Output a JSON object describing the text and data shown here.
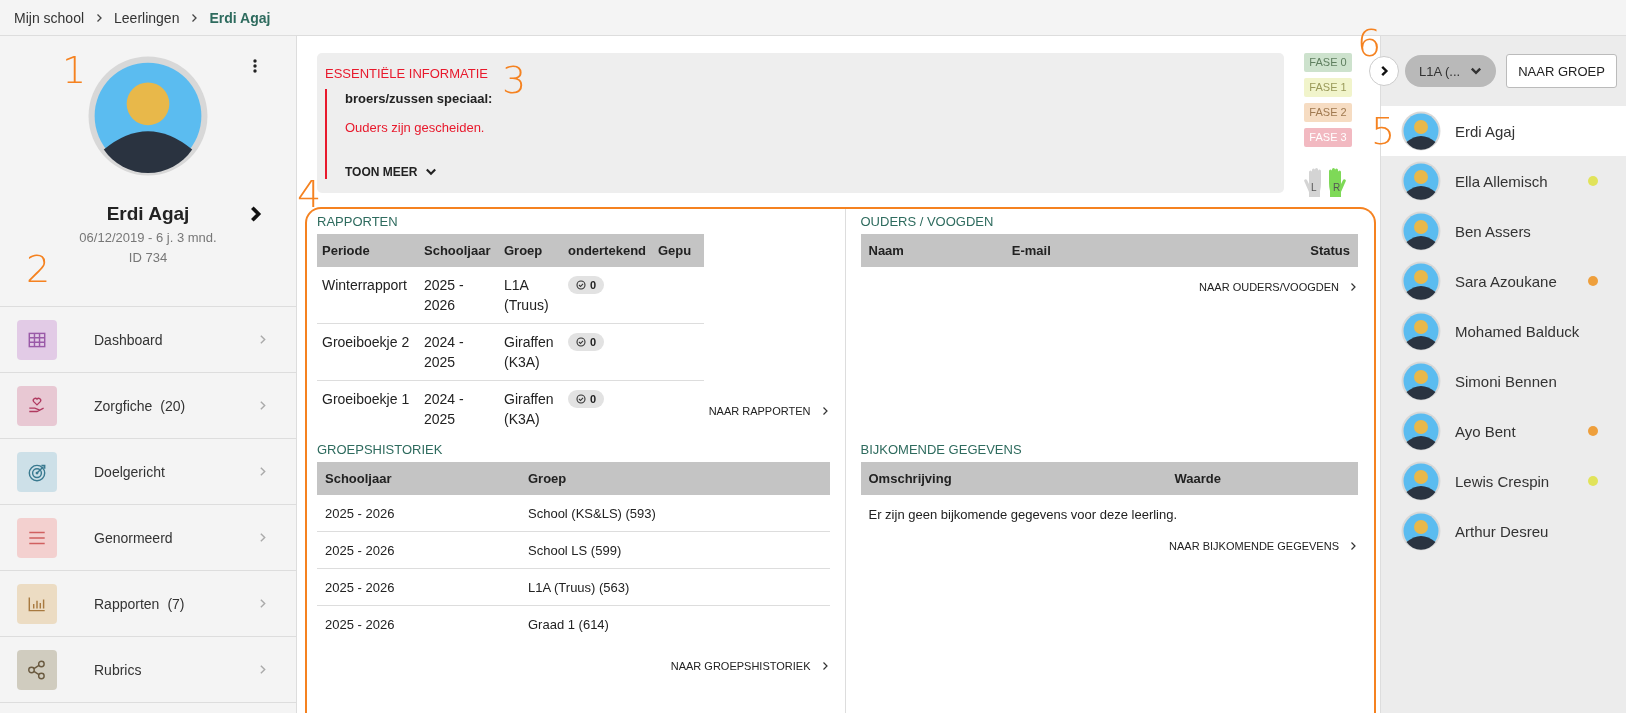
{
  "breadcrumb": [
    {
      "label": "Mijn school",
      "current": false
    },
    {
      "label": "Leerlingen",
      "current": false
    },
    {
      "label": "Erdi Agaj",
      "current": true
    }
  ],
  "profile": {
    "annotation": "1",
    "name": "Erdi Agaj",
    "birth": "06/12/2019 - 6 j. 3 mnd.",
    "id": "ID 734"
  },
  "menu": {
    "annotation": "2",
    "items": [
      {
        "label": "Dashboard",
        "kind": "grid",
        "color": "#e2cbe6"
      },
      {
        "label": "Zorgfiche",
        "count": "(20)",
        "kind": "care",
        "color": "#e8c8d3"
      },
      {
        "label": "Doelgericht",
        "kind": "target",
        "color": "#cde0e8"
      },
      {
        "label": "Genormeerd",
        "kind": "lines",
        "color": "#f3d0cf"
      },
      {
        "label": "Rapporten",
        "count": "(7)",
        "kind": "chart",
        "color": "#ecdcc3"
      },
      {
        "label": "Rubrics",
        "kind": "share",
        "color": "#d0ccbf"
      }
    ]
  },
  "essential_info": {
    "annotation": "3",
    "title": "ESSENTIËLE INFORMATIE",
    "heading": "broers/zussen speciaal:",
    "note": "Ouders zijn gescheiden.",
    "more": "TOON MEER"
  },
  "phases": [
    {
      "label": "FASE 0",
      "color": "#cde2cd"
    },
    {
      "label": "FASE 1",
      "color": "#f1f4cb"
    },
    {
      "label": "FASE 2",
      "color": "#f6dcc2"
    },
    {
      "label": "FASE 3",
      "color": "#f2b9c1"
    }
  ],
  "hands": [
    {
      "label": "L",
      "selected": false
    },
    {
      "label": "R",
      "selected": true
    }
  ],
  "overview": {
    "annotation": "4",
    "reports": {
      "title": "RAPPORTEN",
      "columns": [
        "Periode",
        "Schooljaar",
        "Groep",
        "ondertekend",
        "Gepu"
      ],
      "rows": [
        {
          "cells": [
            "Winterrapport",
            "2025 - 2026",
            "L1A (Truus)"
          ],
          "signed": "0"
        },
        {
          "cells": [
            "Groeiboekje 2",
            "2024 - 2025",
            "Giraffen (K3A)"
          ],
          "signed": "0"
        },
        {
          "cells": [
            "Groeiboekje 1",
            "2024 - 2025",
            "Giraffen (K3A)"
          ],
          "signed": "0"
        }
      ],
      "link": "NAAR RAPPORTEN"
    },
    "guardians": {
      "title": "OUDERS / VOOGDEN",
      "columns": [
        "Naam",
        "E-mail",
        "Status"
      ],
      "link": "NAAR OUDERS/VOOGDEN"
    },
    "group_history": {
      "title": "GROEPSHISTORIEK",
      "columns": [
        "Schooljaar",
        "Groep"
      ],
      "rows": [
        [
          "2025 - 2026",
          "School (KS&LS) (593)"
        ],
        [
          "2025 - 2026",
          "School LS (599)"
        ],
        [
          "2025 - 2026",
          "L1A (Truus) (563)"
        ],
        [
          "2025 - 2026",
          "Graad 1 (614)"
        ]
      ],
      "link": "NAAR GROEPSHISTORIEK"
    },
    "extra": {
      "title": "BIJKOMENDE GEGEVENS",
      "columns": [
        "Omschrijving",
        "Waarde"
      ],
      "empty": "Er zijn geen bijkomende gegevens voor deze leerling.",
      "link": "NAAR BIJKOMENDE GEGEVENS"
    }
  },
  "group_nav": {
    "annotation": "6",
    "group": "L1A (...",
    "button": "NAAR GROEP"
  },
  "students": {
    "annotation": "5",
    "items": [
      {
        "name": "Erdi Agaj",
        "selected": true
      },
      {
        "name": "Ella Allemisch",
        "selected": false,
        "color": "#e1e35a"
      },
      {
        "name": "Ben Assers",
        "selected": false
      },
      {
        "name": "Sara Azoukane",
        "selected": false,
        "color": "#ee9f3c"
      },
      {
        "name": "Mohamed Balduck",
        "selected": false
      },
      {
        "name": "Simoni Bennen",
        "selected": false
      },
      {
        "name": "Ayo Bent",
        "selected": false,
        "color": "#ee9f3c"
      },
      {
        "name": "Lewis Crespin",
        "selected": false,
        "color": "#e1e35a"
      },
      {
        "name": "Arthur Desreu",
        "selected": false
      }
    ]
  }
}
